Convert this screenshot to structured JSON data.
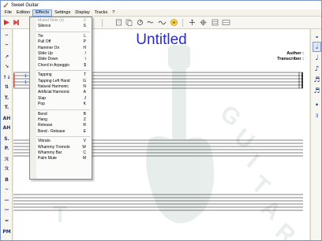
{
  "window": {
    "title": "Sweet Guitar"
  },
  "menubar": {
    "items": [
      "File",
      "Edition",
      "Effects",
      "Settings",
      "Display",
      "Tracks",
      "?"
    ],
    "active": "Effects"
  },
  "toolbar": {
    "icons": [
      "play-icon",
      "record-icon",
      "snake-icon",
      "page-icon",
      "loop-icon",
      "wave-icon",
      "metronome-icon",
      "move-icon",
      "crosshair-icon",
      "grid-icon",
      "list-icon"
    ]
  },
  "left_toolbar": {
    "labels": [
      "⌢",
      "⌣",
      "↗",
      "↘",
      "↑↓",
      "⇅",
      "T.",
      "T.",
      "AH",
      "AH",
      "S.",
      "P.",
      "ℛ",
      "ℛ",
      "B",
      "~",
      "—",
      "—",
      "≈",
      "PM"
    ]
  },
  "right_toolbar": {
    "notes": [
      "𝅝",
      "𝅗𝅥",
      "♩",
      "♪",
      "♬",
      "♬",
      "•",
      "3"
    ]
  },
  "score": {
    "title": "Untitled",
    "author_label": "Author :",
    "transcriber_label": "Transcriber :",
    "watermark_text": "GUITAR"
  },
  "effects_menu": {
    "groups": [
      [
        {
          "label": "Muted Note (x)",
          "key": "X",
          "disabled": true
        },
        {
          "label": "Silence",
          "key": "S",
          "disabled": false
        }
      ],
      [
        {
          "label": "Tie",
          "key": "L",
          "disabled": false
        },
        {
          "label": "Pull Off",
          "key": "P",
          "disabled": false
        },
        {
          "label": "Hammer On",
          "key": "H",
          "disabled": false
        },
        {
          "label": "Slide Up",
          "key": "/",
          "disabled": false
        },
        {
          "label": "Slide Down",
          "key": "\\",
          "disabled": false
        },
        {
          "label": "Chord in Arpeggio",
          "key": "$",
          "disabled": false
        }
      ],
      [
        {
          "label": "Tapping",
          "key": "T",
          "disabled": false
        },
        {
          "label": "Tapping Left Hand",
          "key": "G",
          "disabled": false
        },
        {
          "label": "Natural Harmonic",
          "key": "N",
          "disabled": false
        },
        {
          "label": "Artificial Harmonic",
          "key": "A",
          "disabled": false
        },
        {
          "label": "Slap",
          "key": "J",
          "disabled": false
        },
        {
          "label": "Pop",
          "key": "K",
          "disabled": false
        }
      ],
      [
        {
          "label": "Bend",
          "key": "B",
          "disabled": false
        },
        {
          "label": "Hang",
          "key": "Z",
          "disabled": false
        },
        {
          "label": "Release",
          "key": "R",
          "disabled": false
        },
        {
          "label": "Bend - Release",
          "key": "E",
          "disabled": false
        }
      ],
      [
        {
          "label": "Vibrato",
          "key": "V",
          "disabled": false
        },
        {
          "label": "Whammy Tremolo",
          "key": "W",
          "disabled": false
        },
        {
          "label": "Whammy Bar",
          "key": "C",
          "disabled": false
        },
        {
          "label": "Palm Mute",
          "key": "M",
          "disabled": false
        }
      ]
    ]
  },
  "colors": {
    "title_blue": "#2a2ad0",
    "tab_number_blue": "#2f74c8",
    "cursor_red": "#ff2a2a",
    "accent": "#7a9fd8"
  },
  "tab_numbers": [
    "1",
    "1"
  ]
}
